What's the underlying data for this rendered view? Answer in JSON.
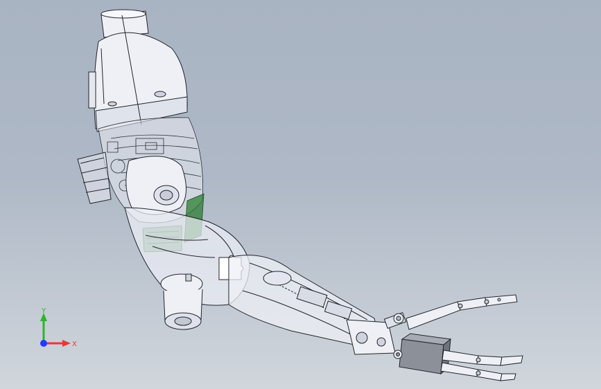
{
  "viewport": {
    "background_top": "#a9b4c3",
    "background_bottom": "#d1d6dc"
  },
  "model": {
    "subject": "robotic-arm-assembly",
    "body_color": "#eef0f6",
    "edge_color": "#20242c",
    "accent_color": "#2e7d32"
  },
  "triad": {
    "y_label": "Y",
    "x_label": "X",
    "y_color": "#2db52d",
    "x_color": "#e53935",
    "z_color": "#1e3cff"
  }
}
